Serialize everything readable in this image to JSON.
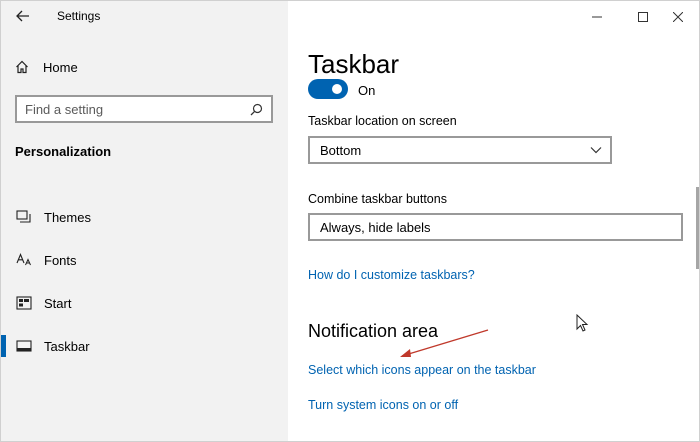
{
  "window": {
    "title": "Settings"
  },
  "sidebar": {
    "home_label": "Home",
    "search_placeholder": "Find a setting",
    "section_title": "Personalization",
    "items": [
      {
        "label": "Themes",
        "icon": "themes-icon"
      },
      {
        "label": "Fonts",
        "icon": "fonts-icon"
      },
      {
        "label": "Start",
        "icon": "start-icon"
      },
      {
        "label": "Taskbar",
        "icon": "taskbar-icon",
        "active": true
      }
    ]
  },
  "main": {
    "page_title": "Taskbar",
    "toggle": {
      "state_label": "On",
      "on": true
    },
    "location": {
      "label": "Taskbar location on screen",
      "value": "Bottom"
    },
    "combine": {
      "label": "Combine taskbar buttons",
      "value": "Always, hide labels"
    },
    "customize_link": "How do I customize taskbars?",
    "notification": {
      "heading": "Notification area",
      "link_select_icons": "Select which icons appear on the taskbar",
      "link_system_icons": "Turn system icons on or off"
    }
  },
  "colors": {
    "accent": "#0063b1",
    "annotation_arrow": "#c0392b",
    "sidebar_bg": "#f2f2f2"
  }
}
